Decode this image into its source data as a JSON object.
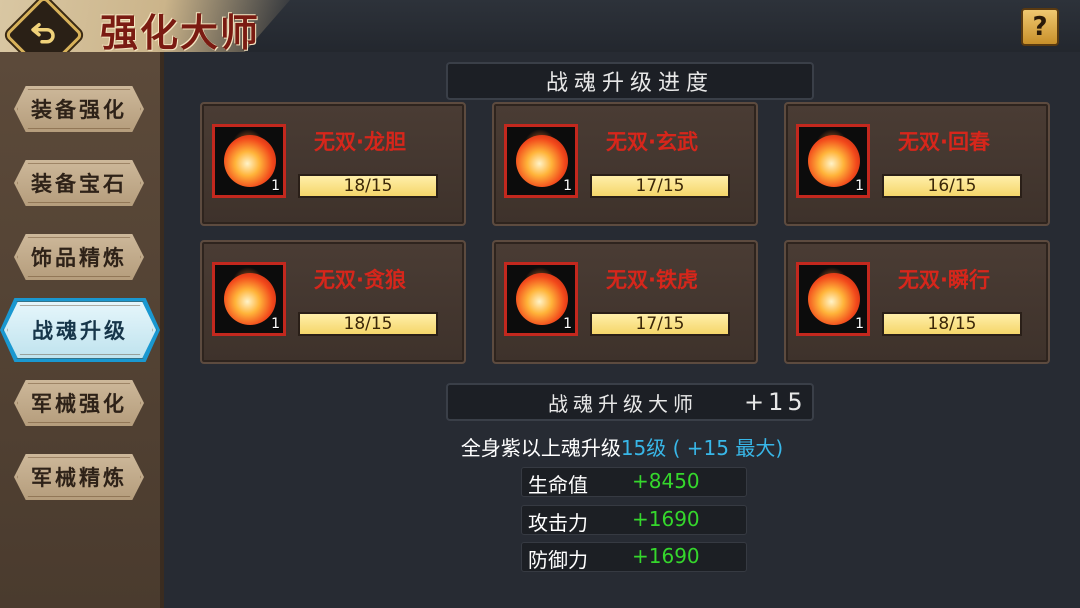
{
  "header": {
    "title": "强化大师",
    "help_label": "?"
  },
  "sidebar": {
    "items": [
      {
        "label": "装备强化"
      },
      {
        "label": "装备宝石"
      },
      {
        "label": "饰品精炼"
      },
      {
        "label": "战魂升级",
        "active": true
      },
      {
        "label": "军械强化"
      },
      {
        "label": "军械精炼"
      }
    ]
  },
  "progress_section": {
    "title": "战魂升级进度",
    "cards": [
      {
        "name": "无双·龙胆",
        "count": "1",
        "progress_text": "18/15",
        "progress": 1.0,
        "icon": "dragon-soul-icon"
      },
      {
        "name": "无双·玄武",
        "count": "1",
        "progress_text": "17/15",
        "progress": 1.0,
        "icon": "shield-soul-icon"
      },
      {
        "name": "无双·回春",
        "count": "1",
        "progress_text": "16/15",
        "progress": 1.0,
        "icon": "heart-soul-icon"
      },
      {
        "name": "无双·贪狼",
        "count": "1",
        "progress_text": "18/15",
        "progress": 1.0,
        "icon": "wolf-soul-icon"
      },
      {
        "name": "无双·铁虎",
        "count": "1",
        "progress_text": "17/15",
        "progress": 1.0,
        "icon": "tiger-soul-icon"
      },
      {
        "name": "无双·瞬行",
        "count": "1",
        "progress_text": "18/15",
        "progress": 1.0,
        "icon": "phoenix-soul-icon"
      }
    ]
  },
  "master_section": {
    "title": "战魂升级大师",
    "level": "+15",
    "requirement_prefix": "全身紫以上魂升级",
    "requirement_highlight": "15级 ( +15 最大)",
    "stats": [
      {
        "label": "生命值",
        "value": "+8450"
      },
      {
        "label": "攻击力",
        "value": "+1690"
      },
      {
        "label": "防御力",
        "value": "+1690"
      }
    ]
  },
  "colors": {
    "soul_name": "#d6261b",
    "progress_fill": "#f5d66a",
    "highlight_blue": "#38b7e8",
    "stat_green": "#35d72c",
    "active_tab": "#1a98d0"
  }
}
